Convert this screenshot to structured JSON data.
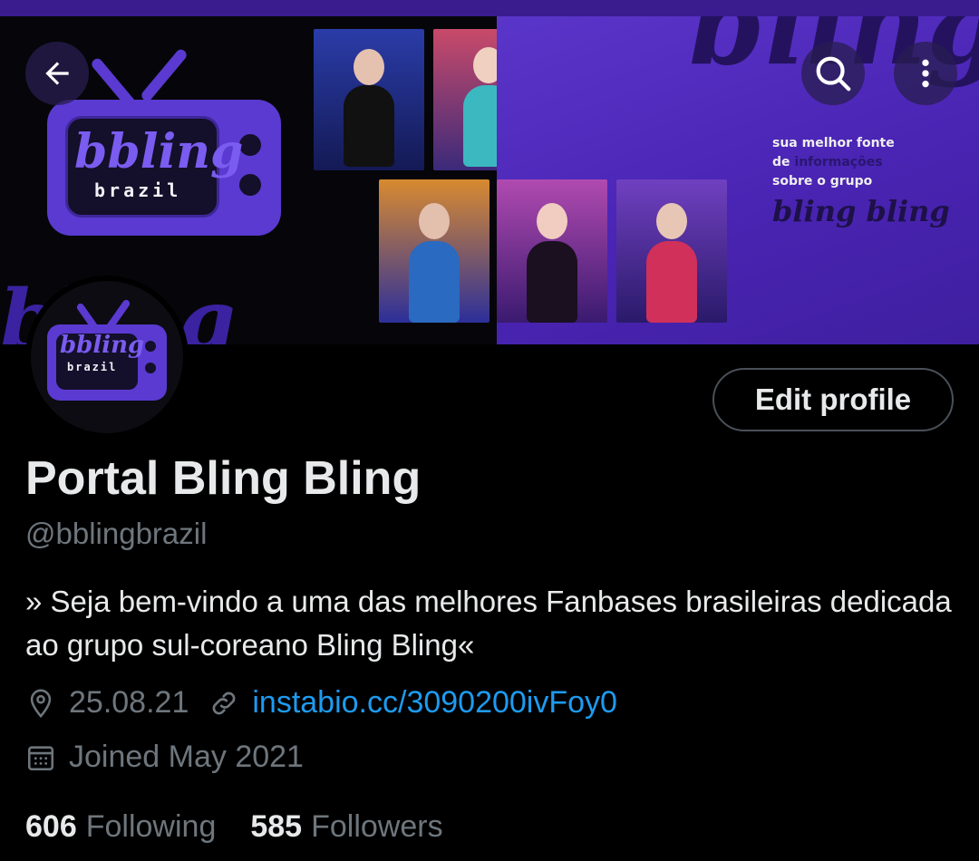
{
  "banner": {
    "tv_brand": "bbling",
    "tv_sub": "brazil",
    "tagline_line1": "sua melhor fonte",
    "tagline_line2_pre": "de ",
    "tagline_line2_accent": "informações",
    "tagline_line3": "sobre o grupo",
    "tagline_script": "bling bling",
    "big_script": "bling"
  },
  "avatar": {
    "brand": "bbling",
    "sub": "brazil"
  },
  "toolbar": {
    "back_icon": "arrow-left-icon",
    "search_icon": "search-icon",
    "more_icon": "more-vertical-icon"
  },
  "profile": {
    "edit_label": "Edit profile",
    "name": "Portal Bling Bling",
    "handle": "@bblingbrazil",
    "bio": "» Seja bem-vindo a uma das melhores Fanbases brasileiras dedicada ao grupo sul-coreano Bling Bling«",
    "location": "25.08.21",
    "website": "instabio.cc/3090200ivFoy0",
    "joined": "Joined May 2021",
    "following_count": "606",
    "following_label": "Following",
    "followers_count": "585",
    "followers_label": "Followers"
  },
  "colors": {
    "accent_link": "#1d9bf0",
    "banner_purple": "#4a24b3",
    "secondary_text": "#6e767d"
  }
}
